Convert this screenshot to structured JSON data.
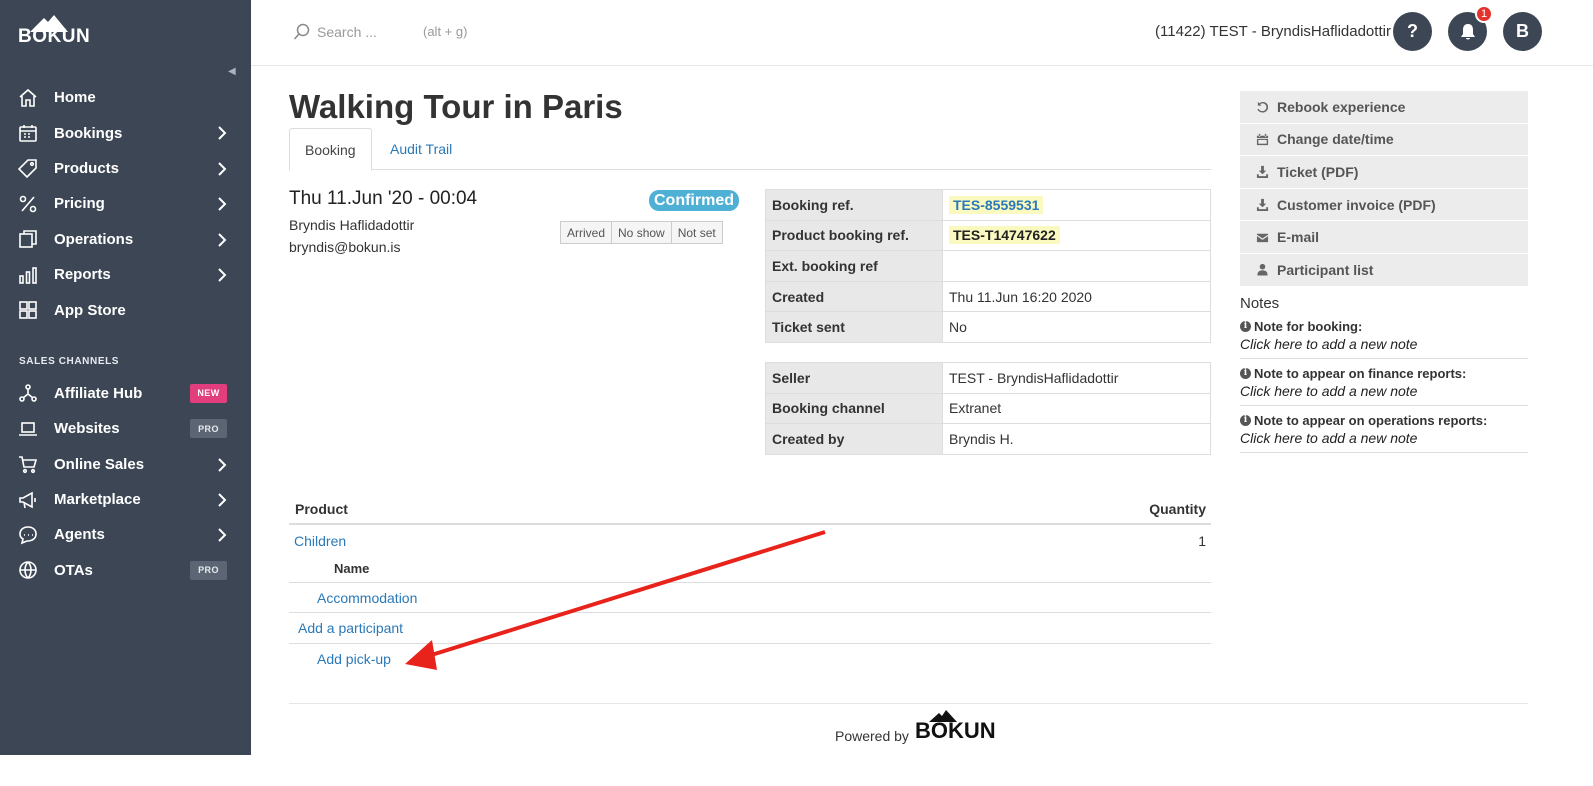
{
  "brand": {
    "name": "BÓKUN"
  },
  "sidebar": {
    "items": [
      {
        "label": "Home",
        "icon": "home-icon",
        "chevron": false
      },
      {
        "label": "Bookings",
        "icon": "calendar-icon",
        "chevron": true
      },
      {
        "label": "Products",
        "icon": "tag-icon",
        "chevron": true
      },
      {
        "label": "Pricing",
        "icon": "percent-icon",
        "chevron": true
      },
      {
        "label": "Operations",
        "icon": "copy-icon",
        "chevron": true
      },
      {
        "label": "Reports",
        "icon": "bar-chart-icon",
        "chevron": true
      },
      {
        "label": "App Store",
        "icon": "grid-icon",
        "chevron": false
      }
    ],
    "section_title": "SALES CHANNELS",
    "channels": [
      {
        "label": "Affiliate Hub",
        "icon": "network-icon",
        "badge": "NEW"
      },
      {
        "label": "Websites",
        "icon": "laptop-icon",
        "badge": "PRO"
      },
      {
        "label": "Online Sales",
        "icon": "cart-icon",
        "chevron": true
      },
      {
        "label": "Marketplace",
        "icon": "megaphone-icon",
        "chevron": true
      },
      {
        "label": "Agents",
        "icon": "chat-icon",
        "chevron": true
      },
      {
        "label": "OTAs",
        "icon": "globe-icon",
        "badge": "PRO"
      }
    ]
  },
  "topbar": {
    "search_placeholder": "Search ...",
    "search_hint": "(alt + g)",
    "account": "(11422) TEST - BryndisHaflidadottir",
    "help_label": "?",
    "notification_count": "1",
    "avatar_letter": "B"
  },
  "page": {
    "title": "Walking Tour in Paris",
    "tabs": [
      "Booking",
      "Audit Trail"
    ],
    "date": "Thu 11.Jun '20 - 00:04",
    "customer_name": "Bryndis Haflidadottir",
    "customer_email": "bryndis@bokun.is",
    "status": "Confirmed",
    "arrival_buttons": [
      "Arrived",
      "No show",
      "Not set"
    ]
  },
  "booking_info": [
    {
      "key": "Booking ref.",
      "value": "TES-8559531"
    },
    {
      "key": "Product booking ref.",
      "value": "TES-T14747622"
    },
    {
      "key": "Ext. booking ref",
      "value": ""
    },
    {
      "key": "Created",
      "value": "Thu 11.Jun 16:20 2020"
    },
    {
      "key": "Ticket sent",
      "value": "No"
    }
  ],
  "seller_info": [
    {
      "key": "Seller",
      "value": "TEST - BryndisHaflidadottir"
    },
    {
      "key": "Booking channel",
      "value": "Extranet"
    },
    {
      "key": "Created by",
      "value": "Bryndis H."
    }
  ],
  "products": {
    "header_product": "Product",
    "header_quantity": "Quantity",
    "rows": [
      {
        "name": "Children",
        "quantity": "1"
      }
    ],
    "name_header": "Name",
    "accommodation": "Accommodation",
    "add_participant": "Add a participant",
    "add_pickup": "Add pick-up"
  },
  "actions": [
    {
      "label": "Rebook experience",
      "icon": "undo-icon"
    },
    {
      "label": "Change date/time",
      "icon": "calendar-icon"
    },
    {
      "label": "Ticket (PDF)",
      "icon": "download-icon"
    },
    {
      "label": "Customer invoice (PDF)",
      "icon": "download-icon"
    },
    {
      "label": "E-mail",
      "icon": "envelope-icon"
    },
    {
      "label": "Participant list",
      "icon": "user-icon"
    }
  ],
  "notes": {
    "title": "Notes",
    "items": [
      {
        "label": "Note for booking:",
        "action": "Click here to add a new note"
      },
      {
        "label": "Note to appear on finance reports:",
        "action": "Click here to add a new note"
      },
      {
        "label": "Note to appear on operations reports:",
        "action": "Click here to add a new note"
      }
    ]
  },
  "footer": {
    "powered_by": "Powered by",
    "brand": "BÓKUN"
  },
  "colors": {
    "sidebar": "#3c4654",
    "link": "#2a79b8",
    "status": "#4fb0d6",
    "new_badge": "#e23d7c",
    "annotation_arrow": "#e8231c"
  }
}
